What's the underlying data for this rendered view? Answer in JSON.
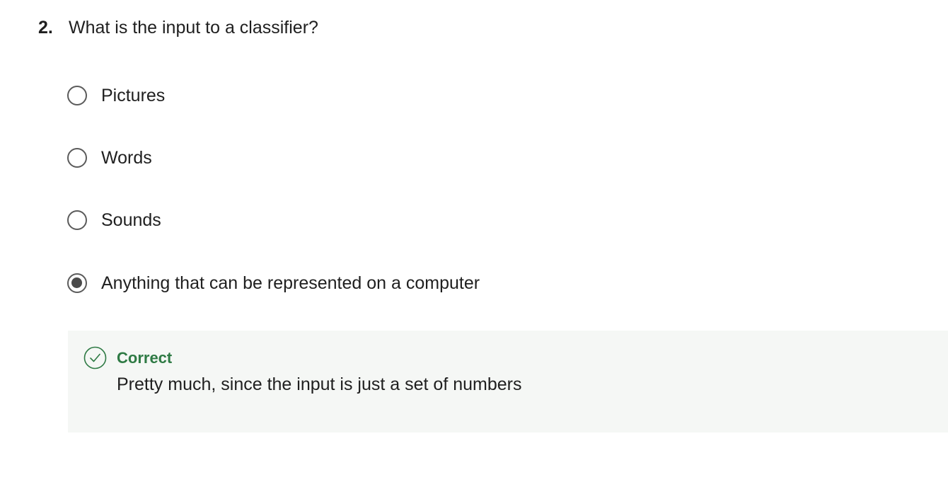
{
  "question": {
    "number": "2.",
    "text": "What is the input to a classifier?"
  },
  "options": [
    {
      "label": "Pictures",
      "selected": false
    },
    {
      "label": "Words",
      "selected": false
    },
    {
      "label": "Sounds",
      "selected": false
    },
    {
      "label": "Anything that can be represented on a  computer",
      "selected": true
    }
  ],
  "feedback": {
    "status": "Correct",
    "message": "Pretty much, since the input is just a set of numbers",
    "icon": "check-circle-icon",
    "color": "#2e7a44",
    "background": "#f5f7f5"
  }
}
